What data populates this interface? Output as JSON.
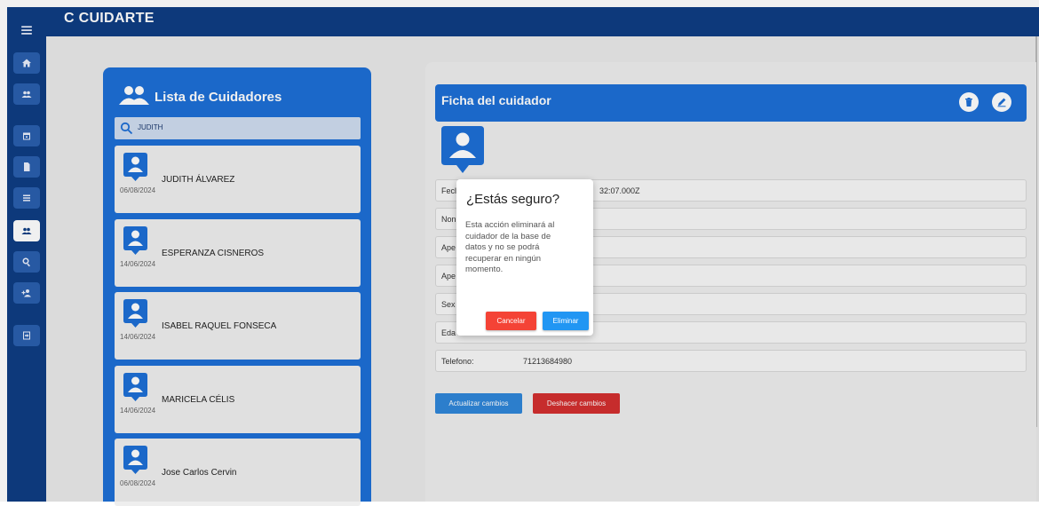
{
  "app": {
    "title": "C CUIDARTE"
  },
  "sidebar": {
    "items": [
      "menu-icon",
      "home-icon",
      "people-icon",
      "calendar-icon",
      "document-icon",
      "list-icon",
      "caregivers-icon",
      "search-icon",
      "add-user-icon",
      "logout-icon"
    ]
  },
  "list": {
    "title": "Lista de Cuidadores",
    "search_value": "JUDITH",
    "cards": [
      {
        "name": "JUDITH ÁLVAREZ",
        "date": "06/08/2024"
      },
      {
        "name": "ESPERANZA CISNEROS",
        "date": "14/06/2024"
      },
      {
        "name": "ISABEL RAQUEL FONSECA",
        "date": "14/06/2024"
      },
      {
        "name": "MARICELA CÉLIS",
        "date": "14/06/2024"
      },
      {
        "name": "Jose Carlos Cervin",
        "date": "06/08/2024"
      }
    ]
  },
  "ficha": {
    "title": "Ficha del cuidador",
    "fields": [
      {
        "label": "Fecl",
        "value": "32:07.000Z"
      },
      {
        "label": "Non",
        "value": ""
      },
      {
        "label": "Ape",
        "value": ""
      },
      {
        "label": "Ape",
        "value": ""
      },
      {
        "label": "Sex",
        "value": ""
      },
      {
        "label": "Eda",
        "value": ""
      },
      {
        "label": "Telefono:",
        "value": "71213684980"
      }
    ],
    "update_label": "Actualizar cambios",
    "undo_label": "Deshacer cambios"
  },
  "modal": {
    "title": "¿Estás seguro?",
    "message": "Esta acción eliminará al cuidador de la base de datos y no se podrá recuperar en ningún momento.",
    "cancel_label": "Cancelar",
    "confirm_label": "Eliminar"
  },
  "colors": {
    "navy": "#0e3d83",
    "primary": "#1d6fd6",
    "cancel": "#f44336",
    "confirm": "#2196f3",
    "undo": "#d32f2f",
    "update": "#2f86d9"
  }
}
